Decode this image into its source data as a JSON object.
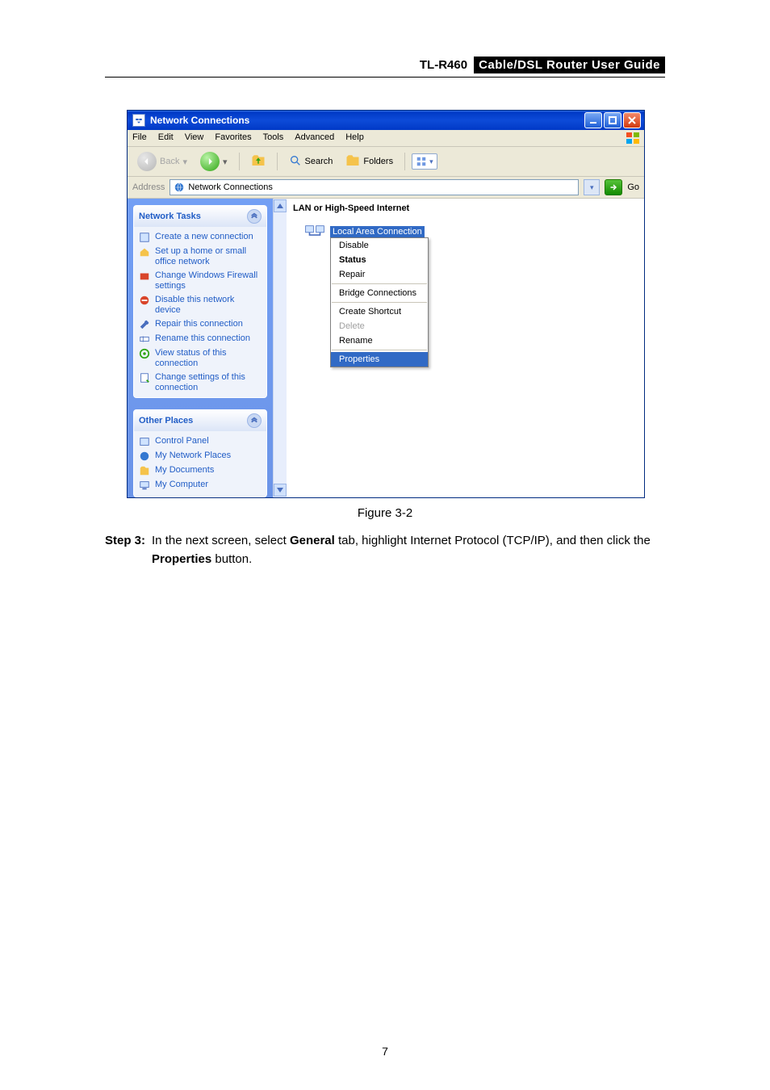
{
  "header": {
    "model": "TL-R460",
    "guide": "Cable/DSL Router User Guide"
  },
  "window": {
    "title": "Network Connections",
    "menus": [
      "File",
      "Edit",
      "View",
      "Favorites",
      "Tools",
      "Advanced",
      "Help"
    ],
    "toolbar": {
      "back": "Back",
      "search": "Search",
      "folders": "Folders"
    },
    "address": {
      "label": "Address",
      "value": "Network Connections",
      "go": "Go"
    },
    "sidepane": {
      "tasks_header": "Network Tasks",
      "tasks": [
        "Create a new connection",
        "Set up a home or small office network",
        "Change Windows Firewall settings",
        "Disable this network device",
        "Repair this connection",
        "Rename this connection",
        "View status of this connection",
        "Change settings of this connection"
      ],
      "other_header": "Other Places",
      "other": [
        "Control Panel",
        "My Network Places",
        "My Documents",
        "My Computer"
      ]
    },
    "main": {
      "category": "LAN or High-Speed Internet",
      "item_label": "Local Area Connection",
      "context_menu": [
        {
          "label": "Disable",
          "state": "normal"
        },
        {
          "label": "Status",
          "state": "bold"
        },
        {
          "label": "Repair",
          "state": "normal"
        },
        {
          "sep": true
        },
        {
          "label": "Bridge Connections",
          "state": "normal"
        },
        {
          "sep": true
        },
        {
          "label": "Create Shortcut",
          "state": "normal"
        },
        {
          "label": "Delete",
          "state": "disabled"
        },
        {
          "label": "Rename",
          "state": "normal"
        },
        {
          "sep": true
        },
        {
          "label": "Properties",
          "state": "highlight"
        }
      ]
    }
  },
  "figure_caption": "Figure 3-2",
  "step": {
    "label": "Step 3:",
    "text_before": "In the next screen, select ",
    "bold1": "General",
    "text_mid": " tab, highlight Internet Protocol (TCP/IP), and then click the ",
    "bold2": "Properties",
    "text_after": " button."
  },
  "page_number": "7"
}
